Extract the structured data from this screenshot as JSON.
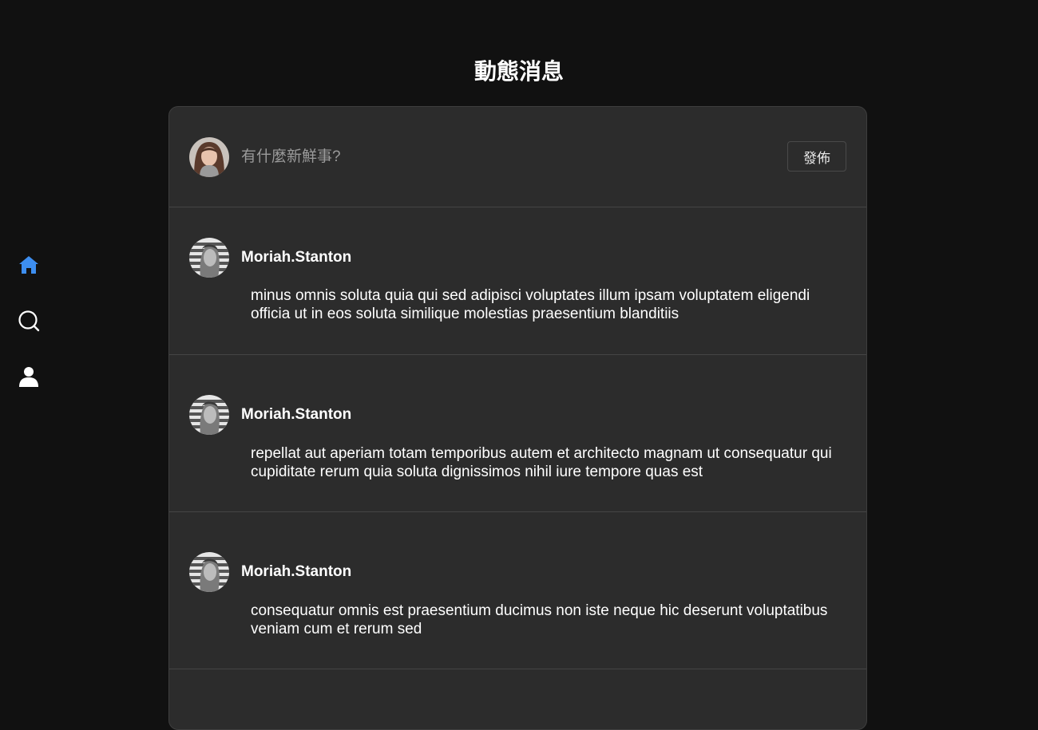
{
  "sidebar": {
    "items": [
      {
        "icon": "home-icon",
        "active": true,
        "color": "#3d8ef0"
      },
      {
        "icon": "search-icon",
        "active": false,
        "color": "#ffffff"
      },
      {
        "icon": "user-icon",
        "active": false,
        "color": "#ffffff"
      }
    ]
  },
  "page": {
    "title": "動態消息"
  },
  "composer": {
    "placeholder": "有什麼新鮮事?",
    "submit_label": "發佈"
  },
  "posts": [
    {
      "author": "Moriah.Stanton",
      "text": "minus omnis soluta quia qui sed adipisci voluptates illum ipsam voluptatem eligendi officia ut in eos soluta similique molestias praesentium blanditiis"
    },
    {
      "author": "Moriah.Stanton",
      "text": "repellat aut aperiam totam temporibus autem et architecto magnam ut consequatur qui cupiditate rerum quia soluta dignissimos nihil iure tempore quas est"
    },
    {
      "author": "Moriah.Stanton",
      "text": "consequatur omnis est praesentium ducimus non iste neque hic deserunt voluptatibus veniam cum et rerum sed"
    }
  ],
  "colors": {
    "background": "#111111",
    "card": "#2c2c2c",
    "accent": "#3d8ef0"
  }
}
